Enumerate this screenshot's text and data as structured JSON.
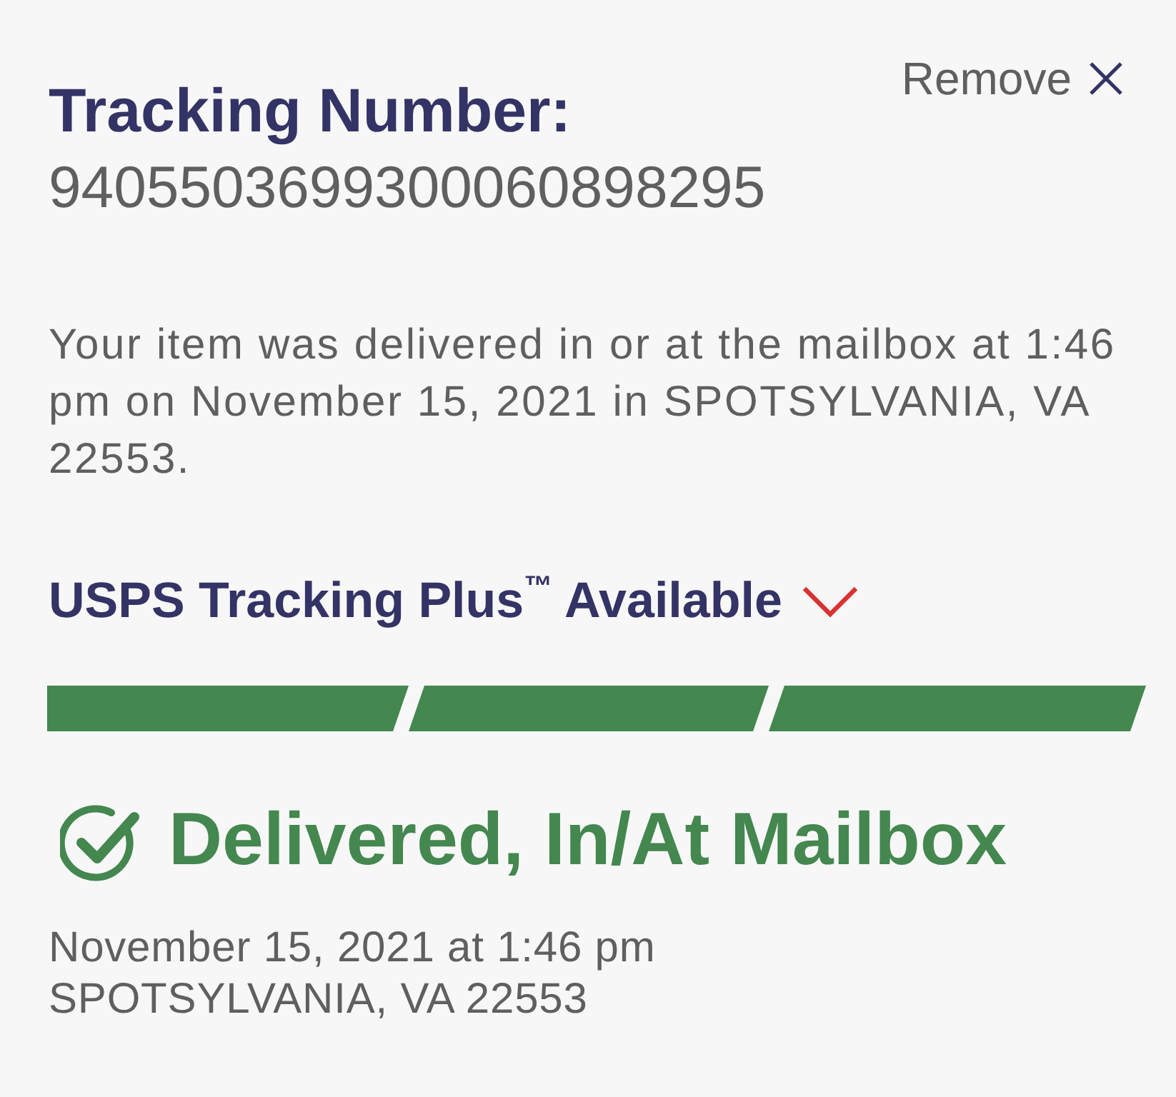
{
  "remove_button": {
    "label": "Remove"
  },
  "tracking": {
    "heading": "Tracking Number:",
    "number": "9405503699300060898295"
  },
  "message": "Your item was delivered in or at the mailbox at 1:46 pm on November 15, 2021 in SPOTSYLVANIA, VA 22553.",
  "tracking_plus": {
    "label": "USPS Tracking Plus$^{™}$ Available",
    "expanded": false
  },
  "progress": {
    "steps": [
      {
        "completed": true
      },
      {
        "completed": true
      },
      {
        "completed": true
      }
    ]
  },
  "status": {
    "title": "Delivered, In/At Mailbox",
    "date": "November 15, 2021 at 1:46 pm",
    "location": "SPOTSYLVANIA, VA 22553"
  }
}
